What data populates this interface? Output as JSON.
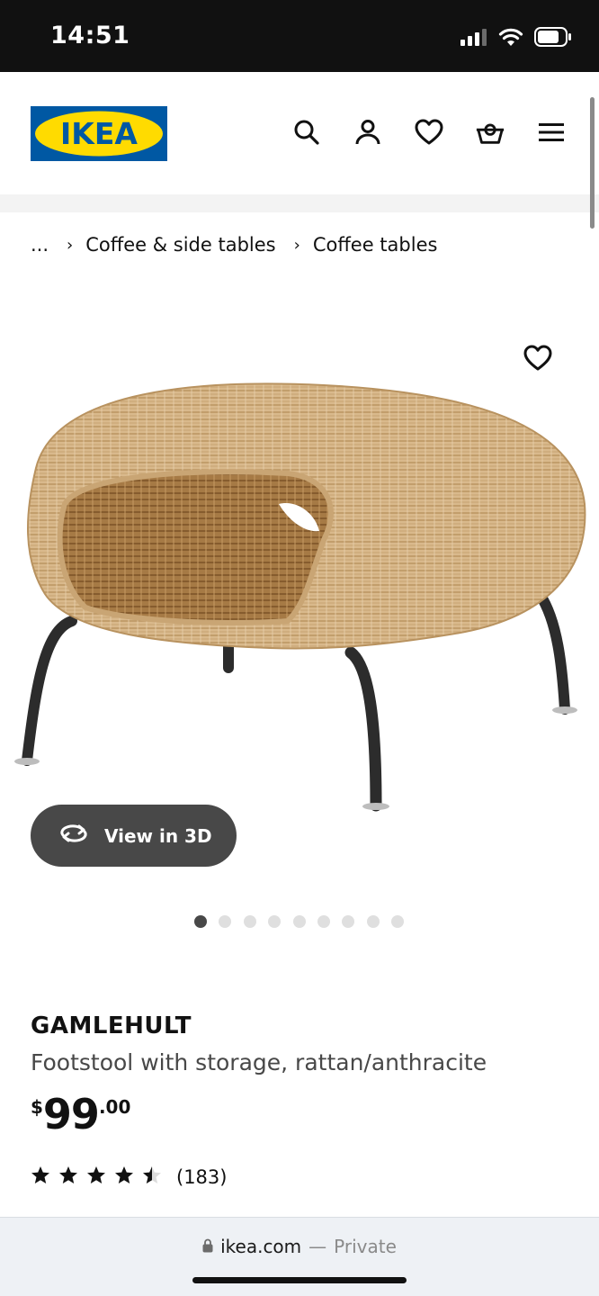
{
  "status_bar": {
    "time": "14:51"
  },
  "header": {
    "brand": "IKEA",
    "colors": {
      "brand_blue": "#0058a3",
      "brand_yellow": "#ffdb00"
    },
    "icons": [
      "search-icon",
      "profile-icon",
      "heart-icon",
      "basket-icon",
      "menu-icon"
    ]
  },
  "breadcrumb": {
    "ellipsis": "...",
    "items": [
      "Coffee & side tables",
      "Coffee tables"
    ]
  },
  "media": {
    "view3d_label": "View in 3D",
    "image_count": 9,
    "active_image": 1
  },
  "product": {
    "name": "GAMLEHULT",
    "description": "Footstool with storage, rattan/anthracite",
    "price": {
      "currency": "$",
      "integer": "99",
      "decimal": ".00"
    },
    "rating": {
      "value": 4.5,
      "max": 5,
      "count_label": "(183)"
    }
  },
  "browser": {
    "domain": "ikea.com",
    "separator": " — ",
    "mode": "Private"
  }
}
